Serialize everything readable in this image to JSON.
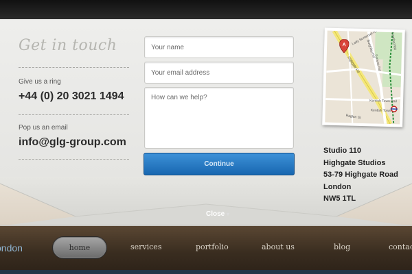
{
  "contact": {
    "tagline": "Get in touch",
    "phone_label": "Give us a ring",
    "phone": "+44 (0) 20 3021 1494",
    "email_label": "Pop us an email",
    "email": "info@glg-group.com"
  },
  "form": {
    "name_placeholder": "Your name",
    "email_placeholder": "Your email address",
    "message_placeholder": "How can we help?",
    "continue_label": "Continue"
  },
  "address": {
    "lines": [
      "Studio 110",
      "Highgate Studios",
      "53-79 Highgate Road",
      "London",
      "NW5 1TL"
    ]
  },
  "map": {
    "marker_label": "A",
    "labels": [
      "Lady Somerset Rd",
      "Burghley Rd",
      "Highgate Rd",
      "Fortess Rd",
      "Lawford Rd",
      "Kentish Town Rail",
      "Kentish Town",
      "Raglan St"
    ]
  },
  "close": {
    "label": "Close",
    "arrow": "▾"
  },
  "nav": {
    "logo_text": "ondon",
    "items": [
      "home",
      "services",
      "portfolio",
      "about us",
      "blog",
      "contact"
    ],
    "active": "home"
  },
  "colors": {
    "accent_blue": "#1e72bd",
    "nav_wood": "#3a2d20",
    "panel_bg": "#e9e9e6"
  }
}
